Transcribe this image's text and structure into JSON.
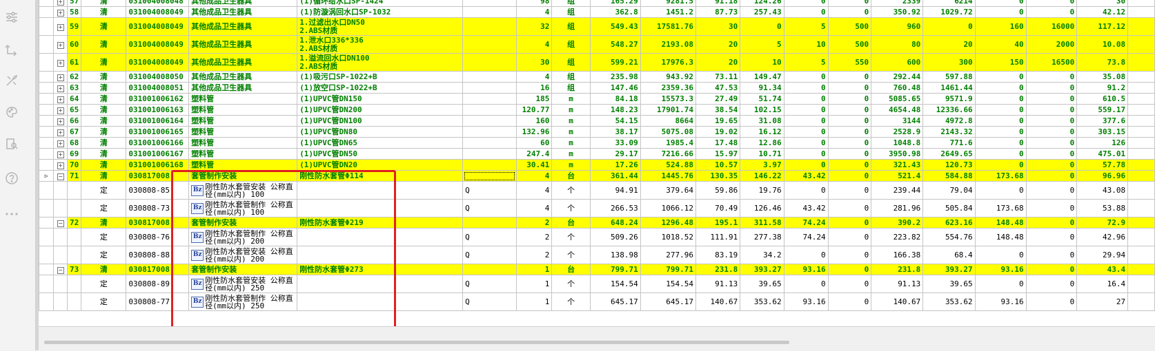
{
  "sidebar": {
    "icons": [
      "sliders-icon",
      "flow-arrows-icon",
      "tools-icon",
      "brush-icon",
      "book-search-icon",
      "help-icon",
      "more-icon"
    ]
  },
  "marks": {
    "qingdan": "清",
    "ding": "定",
    "expand": "+",
    "collapse": "−",
    "bz": "Bz"
  },
  "rows": [
    {
      "type": "qd",
      "hl": false,
      "exp": "+",
      "no": "57",
      "code": "031004008048",
      "name": "其他成品卫生器具",
      "feat": "(1)循环给水口SP-1424",
      "v": [
        "98",
        "组",
        "165.29",
        "9281.5",
        "91.18",
        "124.26",
        "0",
        "0",
        "2339",
        "6214",
        "0",
        "0",
        "30"
      ]
    },
    {
      "type": "qd",
      "hl": false,
      "exp": "+",
      "no": "58",
      "code": "031004008049",
      "name": "其他成品卫生器具",
      "feat": "(1)防漩涡回水口SP-1032",
      "v": [
        "4",
        "组",
        "362.8",
        "1451.2",
        "87.73",
        "257.43",
        "0",
        "0",
        "350.92",
        "1029.72",
        "0",
        "0",
        "42.12"
      ]
    },
    {
      "type": "qd",
      "hl": true,
      "exp": "+",
      "no": "59",
      "code": "031004008049",
      "name": "其他成品卫生器具",
      "feat": [
        "1.过滤出水口DN50",
        "2.ABS材质"
      ],
      "v": [
        "32",
        "组",
        "549.43",
        "17581.76",
        "30",
        "0",
        "5",
        "500",
        "960",
        "0",
        "160",
        "16000",
        "117.12"
      ]
    },
    {
      "type": "qd",
      "hl": true,
      "exp": "+",
      "no": "60",
      "code": "031004008049",
      "name": "其他成品卫生器具",
      "feat": [
        "1.泄水口336*336",
        "2.ABS材质"
      ],
      "v": [
        "4",
        "组",
        "548.27",
        "2193.08",
        "20",
        "5",
        "10",
        "500",
        "80",
        "20",
        "40",
        "2000",
        "10.08"
      ]
    },
    {
      "type": "qd",
      "hl": true,
      "exp": "+",
      "no": "61",
      "code": "031004008049",
      "name": "其他成品卫生器具",
      "feat": [
        "1.溢流回水口DN100",
        "2.ABS材质"
      ],
      "v": [
        "30",
        "组",
        "599.21",
        "17976.3",
        "20",
        "10",
        "5",
        "550",
        "600",
        "300",
        "150",
        "16500",
        "73.8"
      ]
    },
    {
      "type": "qd",
      "hl": false,
      "exp": "+",
      "no": "62",
      "code": "031004008050",
      "name": "其他成品卫生器具",
      "feat": "(1)吸污口SP-1022+B",
      "v": [
        "4",
        "组",
        "235.98",
        "943.92",
        "73.11",
        "149.47",
        "0",
        "0",
        "292.44",
        "597.88",
        "0",
        "0",
        "35.08"
      ]
    },
    {
      "type": "qd",
      "hl": false,
      "exp": "+",
      "no": "63",
      "code": "031004008051",
      "name": "其他成品卫生器具",
      "feat": "(1)放空口SP-1022+B",
      "v": [
        "16",
        "组",
        "147.46",
        "2359.36",
        "47.53",
        "91.34",
        "0",
        "0",
        "760.48",
        "1461.44",
        "0",
        "0",
        "91.2"
      ]
    },
    {
      "type": "qd",
      "hl": false,
      "exp": "+",
      "no": "64",
      "code": "031001006162",
      "name": "塑料管",
      "feat": "(1)UPVC管DN150",
      "v": [
        "185",
        "m",
        "84.18",
        "15573.3",
        "27.49",
        "51.74",
        "0",
        "0",
        "5085.65",
        "9571.9",
        "0",
        "0",
        "610.5"
      ]
    },
    {
      "type": "qd",
      "hl": false,
      "exp": "+",
      "no": "65",
      "code": "031001006163",
      "name": "塑料管",
      "feat": "(1)UPVC管DN200",
      "v": [
        "120.77",
        "m",
        "148.23",
        "17901.74",
        "38.54",
        "102.15",
        "0",
        "0",
        "4654.48",
        "12336.66",
        "0",
        "0",
        "559.17"
      ]
    },
    {
      "type": "qd",
      "hl": false,
      "exp": "+",
      "no": "66",
      "code": "031001006164",
      "name": "塑料管",
      "feat": "(1)UPVC管DN100",
      "v": [
        "160",
        "m",
        "54.15",
        "8664",
        "19.65",
        "31.08",
        "0",
        "0",
        "3144",
        "4972.8",
        "0",
        "0",
        "377.6"
      ]
    },
    {
      "type": "qd",
      "hl": false,
      "exp": "+",
      "no": "67",
      "code": "031001006165",
      "name": "塑料管",
      "feat": "(1)UPVC管DN80",
      "v": [
        "132.96",
        "m",
        "38.17",
        "5075.08",
        "19.02",
        "16.12",
        "0",
        "0",
        "2528.9",
        "2143.32",
        "0",
        "0",
        "303.15"
      ]
    },
    {
      "type": "qd",
      "hl": false,
      "exp": "+",
      "no": "68",
      "code": "031001006166",
      "name": "塑料管",
      "feat": "(1)UPVC管DN65",
      "v": [
        "60",
        "m",
        "33.09",
        "1985.4",
        "17.48",
        "12.86",
        "0",
        "0",
        "1048.8",
        "771.6",
        "0",
        "0",
        "126"
      ]
    },
    {
      "type": "qd",
      "hl": false,
      "exp": "+",
      "no": "69",
      "code": "031001006167",
      "name": "塑料管",
      "feat": "(1)UPVC管DN50",
      "v": [
        "247.4",
        "m",
        "29.17",
        "7216.66",
        "15.97",
        "10.71",
        "0",
        "0",
        "3950.98",
        "2649.65",
        "0",
        "0",
        "475.01"
      ]
    },
    {
      "type": "qd",
      "hl": true,
      "exp": "+",
      "no": "70",
      "code": "031001006168",
      "name": "塑料管",
      "feat": "(1)UPVC管DN20",
      "v": [
        "30.41",
        "m",
        "17.26",
        "524.88",
        "10.57",
        "3.97",
        "0",
        "0",
        "321.43",
        "120.73",
        "0",
        "0",
        "57.78"
      ]
    },
    {
      "type": "qd",
      "hl": true,
      "exp": "−",
      "cur": true,
      "no": "71",
      "code": "030817008",
      "name": "套管制作安装",
      "feat": "刚性防水套管Φ114",
      "v": [
        "4",
        "台",
        "361.44",
        "1445.76",
        "130.35",
        "146.22",
        "43.42",
        "0",
        "521.4",
        "584.88",
        "173.68",
        "0",
        "96.96"
      ]
    },
    {
      "type": "de",
      "code": "030808-85",
      "name": "刚性防水套管安装 公称直径(mm以内) 100",
      "q": "Q",
      "v": [
        "4",
        "个",
        "94.91",
        "379.64",
        "59.86",
        "19.76",
        "0",
        "0",
        "239.44",
        "79.04",
        "0",
        "0",
        "43.08"
      ]
    },
    {
      "type": "de",
      "code": "030808-73",
      "name": "刚性防水套管制作 公称直径(mm以内) 100",
      "q": "Q",
      "v": [
        "4",
        "个",
        "266.53",
        "1066.12",
        "70.49",
        "126.46",
        "43.42",
        "0",
        "281.96",
        "505.84",
        "173.68",
        "0",
        "53.88"
      ]
    },
    {
      "type": "qd",
      "hl": true,
      "exp": "−",
      "no": "72",
      "code": "030817008",
      "name": "套管制作安装",
      "feat": "刚性防水套管Φ219",
      "v": [
        "2",
        "台",
        "648.24",
        "1296.48",
        "195.1",
        "311.58",
        "74.24",
        "0",
        "390.2",
        "623.16",
        "148.48",
        "0",
        "72.9"
      ]
    },
    {
      "type": "de",
      "code": "030808-76",
      "name": "刚性防水套管制作 公称直径(mm以内) 200",
      "q": "Q",
      "v": [
        "2",
        "个",
        "509.26",
        "1018.52",
        "111.91",
        "277.38",
        "74.24",
        "0",
        "223.82",
        "554.76",
        "148.48",
        "0",
        "42.96"
      ]
    },
    {
      "type": "de",
      "code": "030808-88",
      "name": "刚性防水套管安装 公称直径(mm以内) 200",
      "q": "Q",
      "v": [
        "2",
        "个",
        "138.98",
        "277.96",
        "83.19",
        "34.2",
        "0",
        "0",
        "166.38",
        "68.4",
        "0",
        "0",
        "29.94"
      ]
    },
    {
      "type": "qd",
      "hl": true,
      "exp": "−",
      "no": "73",
      "code": "030817008",
      "name": "套管制作安装",
      "feat": "刚性防水套管Φ273",
      "v": [
        "1",
        "台",
        "799.71",
        "799.71",
        "231.8",
        "393.27",
        "93.16",
        "0",
        "231.8",
        "393.27",
        "93.16",
        "0",
        "43.4"
      ]
    },
    {
      "type": "de",
      "code": "030808-89",
      "name": "刚性防水套管安装 公称直径(mm以内) 250",
      "q": "Q",
      "v": [
        "1",
        "个",
        "154.54",
        "154.54",
        "91.13",
        "39.65",
        "0",
        "0",
        "91.13",
        "39.65",
        "0",
        "0",
        "16.4"
      ]
    },
    {
      "type": "de",
      "code": "030808-77",
      "name": "刚性防水套管制作 公称直径(mm以内) 250",
      "q": "Q",
      "v": [
        "1",
        "个",
        "645.17",
        "645.17",
        "140.67",
        "353.62",
        "93.16",
        "0",
        "140.67",
        "353.62",
        "93.16",
        "0",
        "27"
      ]
    }
  ]
}
